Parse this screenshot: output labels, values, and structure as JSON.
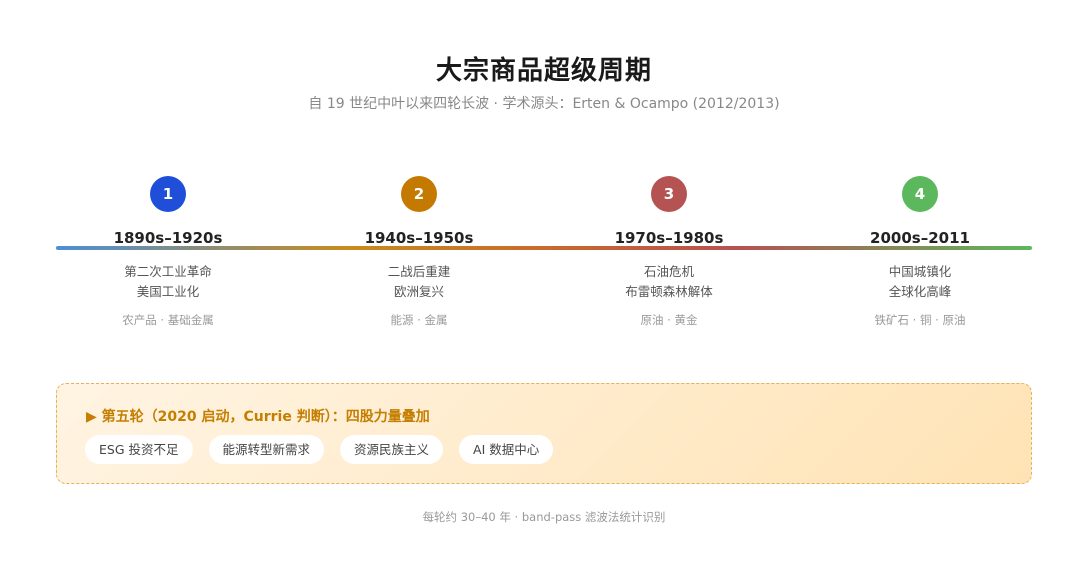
{
  "title": "大宗商品超级周期",
  "subtitle": "自 19 世纪中叶以来四轮长波 · 学术源头：Erten & Ocampo (2012/2013)",
  "eras": [
    {
      "number": "1",
      "color": "#1f4fd8",
      "period": "1890s–1920s",
      "drivers": [
        "第二次工业革命",
        "美国工业化"
      ],
      "assets": "农产品 · 基础金属"
    },
    {
      "number": "2",
      "color": "#c47a00",
      "period": "1940s–1950s",
      "drivers": [
        "二战后重建",
        "欧洲复兴"
      ],
      "assets": "能源 · 金属"
    },
    {
      "number": "3",
      "color": "#b55252",
      "period": "1970s–1980s",
      "drivers": [
        "石油危机",
        "布雷顿森林解体"
      ],
      "assets": "原油 · 黄金"
    },
    {
      "number": "4",
      "color": "#5cb85c",
      "period": "2000s–2011",
      "drivers": [
        "中国城镇化",
        "全球化高峰"
      ],
      "assets": "铁矿石 · 铜 · 原油"
    }
  ],
  "fifth_wave": {
    "heading": "▶ 第五轮（2020 启动，Currie 判断）：四股力量叠加",
    "forces": [
      "ESG 投资不足",
      "能源转型新需求",
      "资源民族主义",
      "AI 数据中心"
    ]
  },
  "footer": "每轮约 30–40 年 · band-pass 滤波法统计识别"
}
